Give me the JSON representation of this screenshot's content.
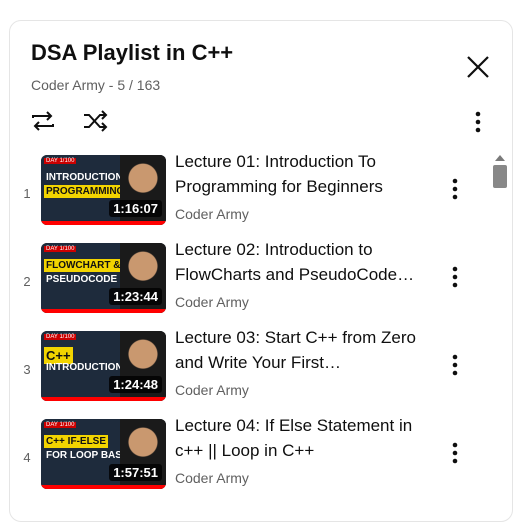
{
  "playlist": {
    "title": "DSA Playlist in C++",
    "subtitle": "Coder Army - 5 / 163",
    "controls": {
      "loop": "loop-icon",
      "shuffle": "shuffle-icon",
      "more": "more-vert-icon"
    },
    "close": "close-icon"
  },
  "videos": [
    {
      "index": "1",
      "title": "Lecture 01: Introduction To Programming for Beginners",
      "channel": "Coder Army",
      "duration": "1:16:07",
      "thumb_text_1": "INTRODUCTION TO",
      "thumb_text_2": "PROGRAMMING",
      "thumb_color": "#f2d400"
    },
    {
      "index": "2",
      "title": "Lecture 02: Introduction to FlowCharts and PseudoCode…",
      "channel": "Coder Army",
      "duration": "1:23:44",
      "thumb_text_1": "FLOWCHART &",
      "thumb_text_2": "PSEUDOCODE",
      "thumb_color": "#f2d400"
    },
    {
      "index": "3",
      "title": "Lecture 03: Start C++ from Zero and Write Your First…",
      "channel": "Coder Army",
      "duration": "1:24:48",
      "thumb_text_1": "C++",
      "thumb_text_2": "INTRODUCTION",
      "thumb_color": "#f2d400"
    },
    {
      "index": "4",
      "title": "Lecture 04: If Else Statement in c++ || Loop in C++",
      "channel": "Coder Army",
      "duration": "1:57:51",
      "thumb_text_1": "C++ IF-ELSE",
      "thumb_text_2": "FOR LOOP BASIC",
      "thumb_color": "#f2d400"
    }
  ],
  "thumb_tag": "DAY 1/100",
  "thumb_brand": "Coder Army",
  "colors": {
    "progress": "#ff0000",
    "title": "#0f0f0f",
    "secondary": "#606060"
  }
}
